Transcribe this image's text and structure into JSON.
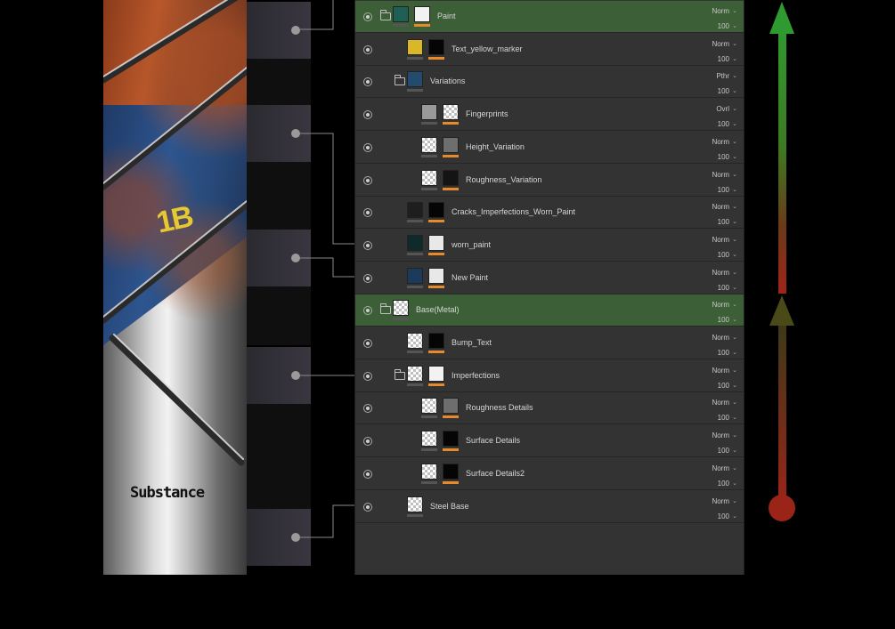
{
  "texture": {
    "marker_text": "1B",
    "stamp_text": "Substance"
  },
  "layers": [
    {
      "name": "Paint",
      "blend": "Norm",
      "opacity": "100",
      "type": "folder",
      "indent": 0,
      "selected": true,
      "icon": "folder-icon",
      "thumbs": [
        "teal-paint",
        "white-mask"
      ]
    },
    {
      "name": "Text_yellow_marker",
      "blend": "Norm",
      "opacity": "100",
      "type": "fill",
      "indent": 1,
      "selected": false,
      "thumbs": [
        "yellow",
        "black-mask"
      ]
    },
    {
      "name": "Variations",
      "blend": "Pthr",
      "opacity": "100",
      "type": "folder",
      "indent": 1,
      "selected": false,
      "icon": "folder-icon",
      "thumbs": [
        "blue"
      ]
    },
    {
      "name": "Fingerprints",
      "blend": "Ovrl",
      "opacity": "100",
      "type": "fill",
      "indent": 2,
      "selected": false,
      "thumbs": [
        "grey",
        "checker-mask"
      ]
    },
    {
      "name": "Height_Variation",
      "blend": "Norm",
      "opacity": "100",
      "type": "fill",
      "indent": 2,
      "selected": false,
      "thumbs": [
        "checker",
        "noise-mask"
      ]
    },
    {
      "name": "Roughness_Variation",
      "blend": "Norm",
      "opacity": "100",
      "type": "fill",
      "indent": 2,
      "selected": false,
      "thumbs": [
        "checker",
        "dark-mask"
      ]
    },
    {
      "name": "Cracks_Imperfections_Worn_Paint",
      "blend": "Norm",
      "opacity": "100",
      "type": "fill",
      "indent": 1,
      "selected": false,
      "thumbs": [
        "dark",
        "black-mask"
      ]
    },
    {
      "name": "worn_paint",
      "blend": "Norm",
      "opacity": "100",
      "type": "fill",
      "indent": 1,
      "selected": false,
      "thumbs": [
        "dark-teal",
        "splatter-mask"
      ]
    },
    {
      "name": "New Paint",
      "blend": "Norm",
      "opacity": "100",
      "type": "fill",
      "indent": 1,
      "selected": false,
      "thumbs": [
        "navy",
        "splatter-mask"
      ]
    },
    {
      "name": "Base(Metal)",
      "blend": "Norm",
      "opacity": "100",
      "type": "folder",
      "indent": 0,
      "selected": true,
      "icon": "folder-icon",
      "thumbs": [
        "checker"
      ]
    },
    {
      "name": "Bump_Text",
      "blend": "Norm",
      "opacity": "100",
      "type": "fill",
      "indent": 1,
      "selected": false,
      "thumbs": [
        "checker",
        "black-mask"
      ]
    },
    {
      "name": "Imperfections",
      "blend": "Norm",
      "opacity": "100",
      "type": "folder",
      "indent": 1,
      "selected": false,
      "icon": "folder-icon",
      "thumbs": [
        "checker",
        "white-mask"
      ]
    },
    {
      "name": "Roughness Details",
      "blend": "Norm",
      "opacity": "100",
      "type": "fill",
      "indent": 2,
      "selected": false,
      "thumbs": [
        "checker",
        "noise-mask"
      ]
    },
    {
      "name": "Surface Details",
      "blend": "Norm",
      "opacity": "100",
      "type": "fill",
      "indent": 2,
      "selected": false,
      "thumbs": [
        "checker",
        "black-mask"
      ]
    },
    {
      "name": "Surface Details2",
      "blend": "Norm",
      "opacity": "100",
      "type": "fill",
      "indent": 2,
      "selected": false,
      "thumbs": [
        "checker",
        "black-mask"
      ]
    },
    {
      "name": "Steel Base",
      "blend": "Norm",
      "opacity": "100",
      "type": "fill",
      "indent": 1,
      "selected": false,
      "thumbs": [
        "checker-grey"
      ]
    }
  ],
  "colors": {
    "panel_bg": "#333333",
    "selected_row": "#3d5f37",
    "mask_bar": "#e8892a",
    "arrow_green": "#2a8a2a",
    "arrow_red": "#a02418"
  }
}
